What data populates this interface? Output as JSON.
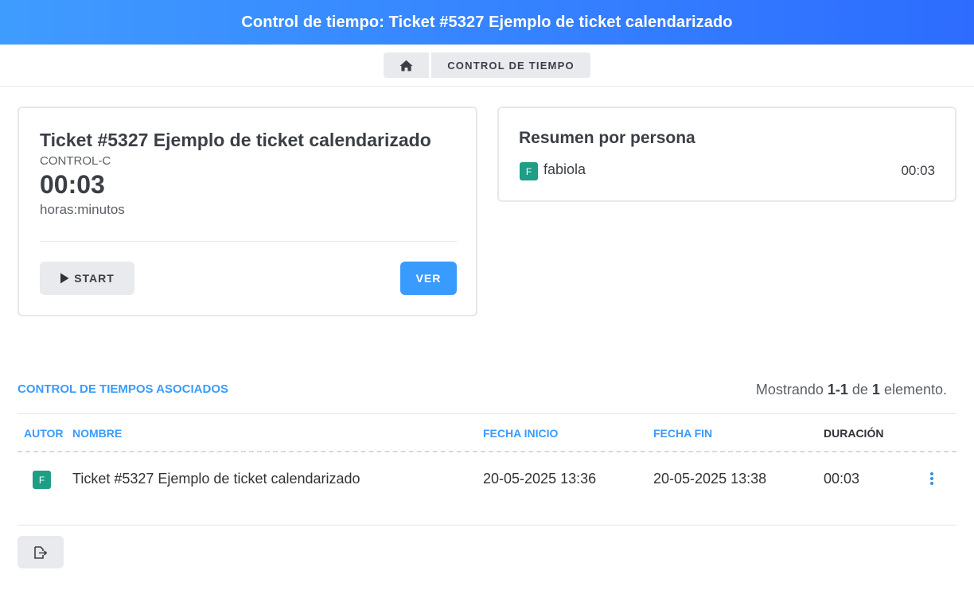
{
  "header": {
    "title": "Control de tiempo: Ticket #5327 Ejemplo de ticket calendarizado"
  },
  "breadcrumb": {
    "home_icon": "home-icon",
    "current": "CONTROL DE TIEMPO"
  },
  "ticket_card": {
    "title": "Ticket #5327 Ejemplo de ticket calendarizado",
    "code": "CONTROL-C",
    "time": "00:03",
    "unit": "horas:minutos",
    "start_label": "START",
    "start_icon": "play-icon",
    "view_label": "VER"
  },
  "summary": {
    "title": "Resumen por persona",
    "people": [
      {
        "initial": "F",
        "name": "fabiola",
        "time": "00:03"
      }
    ]
  },
  "section": {
    "title": "CONTROL DE TIEMPOS ASOCIADOS",
    "showing_prefix": "Mostrando ",
    "showing_range": "1-1",
    "showing_mid": " de ",
    "showing_total": "1",
    "showing_suffix": " elemento."
  },
  "table": {
    "columns": [
      "AUTOR",
      "NOMBRE",
      "FECHA INICIO",
      "FECHA FIN",
      "DURACIÓN"
    ],
    "rows": [
      {
        "author_initial": "F",
        "name": "Ticket #5327 Ejemplo de ticket calendarizado",
        "start": "20-05-2025 13:36",
        "end": "20-05-2025 13:38",
        "duration": "00:03",
        "menu_icon": "kebab-menu-icon"
      }
    ]
  },
  "footer": {
    "export_icon": "export-icon"
  },
  "colors": {
    "accent": "#3a9bff",
    "avatar": "#1e9e84",
    "header_start": "#3f9cff",
    "header_end": "#2d6cff"
  }
}
